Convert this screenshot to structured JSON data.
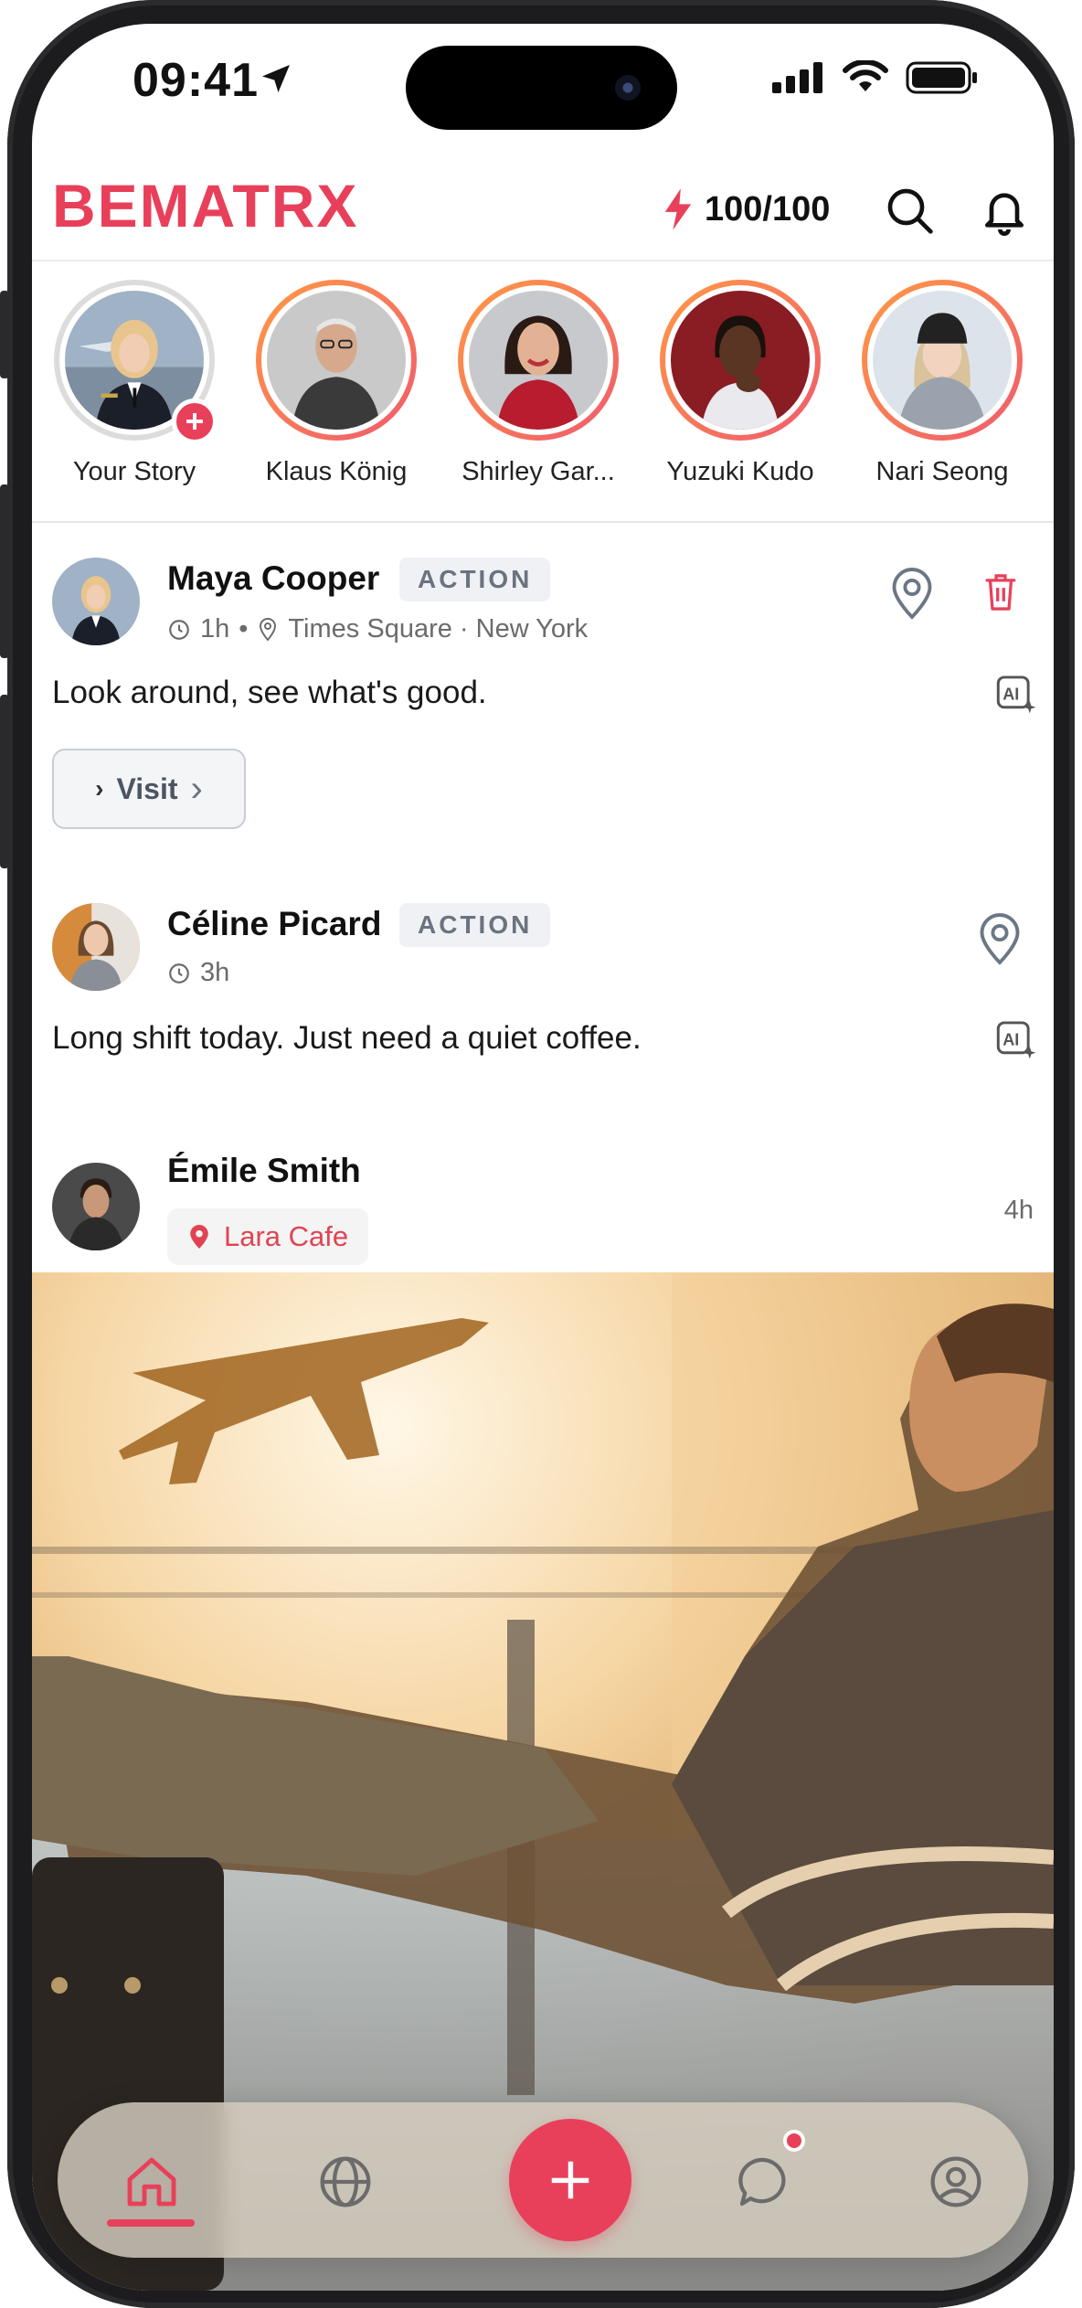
{
  "status_bar": {
    "time": "09:41"
  },
  "header": {
    "logo_text": "BEMATRX",
    "energy": "100/100",
    "brand_color": "#e8405a"
  },
  "stories": [
    {
      "name": "Your Story",
      "own": true
    },
    {
      "name": "Klaus König"
    },
    {
      "name": "Shirley Gar..."
    },
    {
      "name": "Yuzuki Kudo"
    },
    {
      "name": "Nari Seong"
    }
  ],
  "posts": [
    {
      "name": "Maya Cooper",
      "tag": "ACTION",
      "time": "1h",
      "separator": "•",
      "location": "Times Square · New York",
      "text": "Look around, see what's good.",
      "button_label": "Visit"
    },
    {
      "name": "Céline Picard",
      "tag": "ACTION",
      "time": "3h",
      "text": "Long shift today. Just need a quiet coffee."
    },
    {
      "name": "Émile Smith",
      "place": "Lara Cafe",
      "time": "4h"
    }
  ],
  "nav": {
    "items": [
      "home-icon",
      "globe-icon",
      "plus-icon",
      "chat-icon",
      "profile-icon"
    ],
    "active": "home-icon"
  }
}
